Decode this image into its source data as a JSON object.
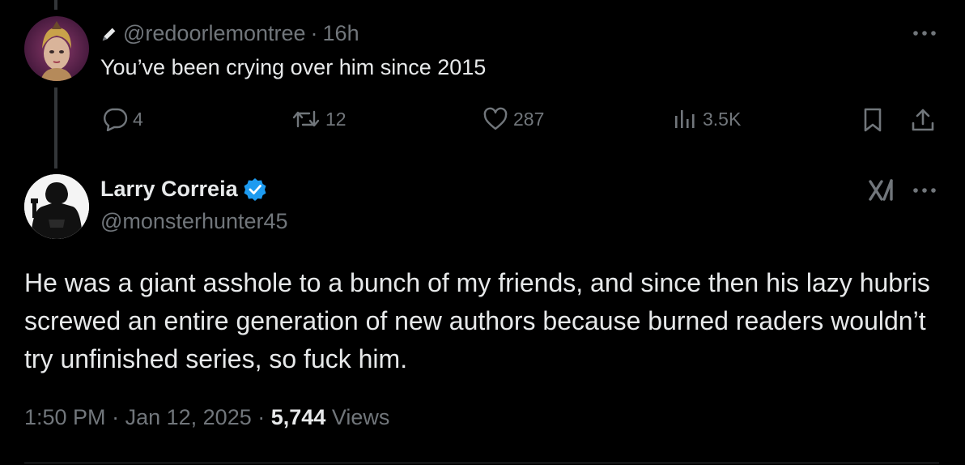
{
  "reply": {
    "handle": "@redoorlemontree",
    "separator": "·",
    "time": "16h",
    "text": "You’ve been crying over him since 2015",
    "actions": {
      "replies": "4",
      "reposts": "12",
      "likes": "287",
      "views": "3.5K"
    },
    "icons": [
      "pencil-icon",
      "more-icon",
      "reply-icon",
      "repost-icon",
      "like-icon",
      "views-icon",
      "bookmark-icon",
      "share-icon"
    ]
  },
  "tweet": {
    "author_name": "Larry Correia",
    "author_handle": "@monsterhunter45",
    "verified": true,
    "body": "He was a giant asshole to a bunch of my friends, and since then his lazy hubris screwed an entire generation of new authors because burned readers wouldn’t try unfinished series, so fuck him.",
    "time": "1:50 PM",
    "sep1": "·",
    "date": "Jan 12, 2025",
    "sep2": "·",
    "views_count": "5,744",
    "views_label": "Views",
    "icons": [
      "grok-icon",
      "more-icon",
      "verified-badge-icon"
    ]
  },
  "colors": {
    "background": "#000000",
    "text_primary": "#e7e9ea",
    "text_secondary": "#71767b",
    "verified_blue": "#1d9bf0",
    "divider": "#2f3336"
  }
}
